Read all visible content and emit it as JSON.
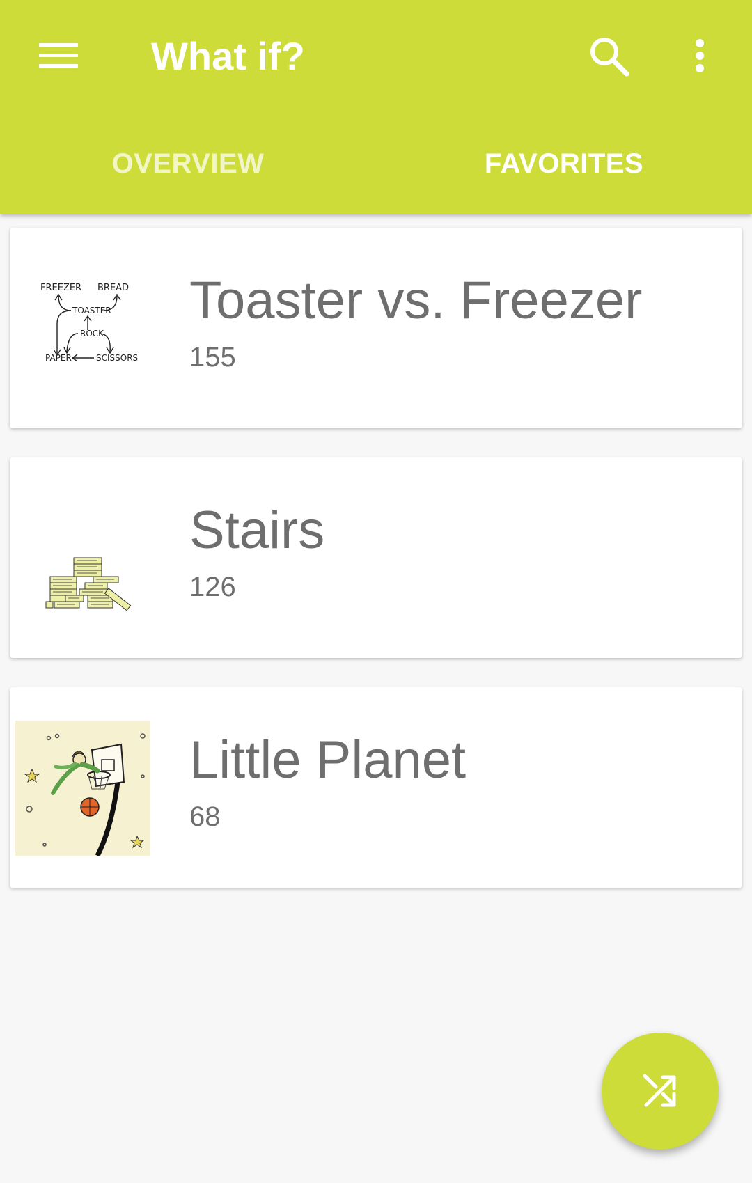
{
  "app_bar": {
    "title": "What if?",
    "menu_icon": "hamburger-menu-icon",
    "search_icon": "search-icon",
    "more_icon": "more-vert-icon",
    "background_color": "#cddc39"
  },
  "tabs": [
    {
      "label": "OVERVIEW",
      "selected": false
    },
    {
      "label": "FAVORITES",
      "selected": true
    }
  ],
  "favorites": [
    {
      "title": "Toaster vs. Freezer",
      "count": "155",
      "thumbnail": "toaster-freezer-diagram"
    },
    {
      "title": "Stairs",
      "count": "126",
      "thumbnail": "unsalted-butter-stairs"
    },
    {
      "title": "Little Planet",
      "count": "68",
      "thumbnail": "little-planet-basketball"
    }
  ],
  "thumbnail_text": {
    "freezer": "FREEZER",
    "bread": "BREAD",
    "toaster": "TOASTER",
    "rock": "ROCK",
    "paper": "PAPER",
    "scissors": "SCISSORS"
  },
  "fab": {
    "icon": "shuffle-icon"
  }
}
